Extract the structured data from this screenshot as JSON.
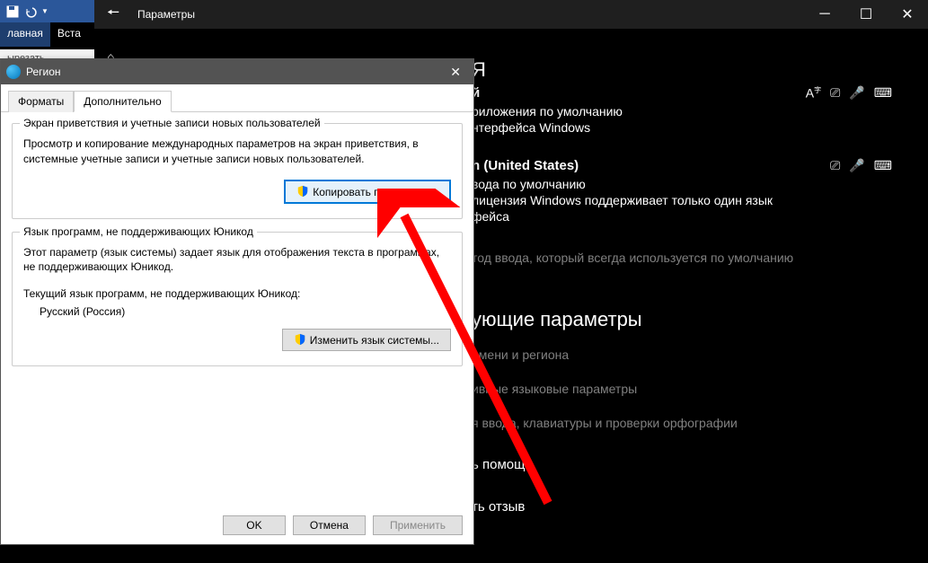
{
  "ribbon": {
    "tab_home": "лавная",
    "tab_insert": "Вста",
    "cut": "ырезать"
  },
  "settings": {
    "title": "Параметры",
    "home_icon": "⌂",
    "search_letter": "Я",
    "lang1": {
      "name_suffix": "й",
      "line1": "риложения по умолчанию",
      "line2": "нтерфейса Windows"
    },
    "lang2": {
      "name": "h (United States)",
      "line1": "вода по умолчанию",
      "line2": "лицензия Windows поддерживает только один язык",
      "line3": "фейса"
    },
    "input_method": "тод ввода, который всегда используется по умолчанию",
    "related_heading": "ующие параметры",
    "related1": "емени и региона",
    "related2": "ивные языковые параметры",
    "related3": "я ввода, клавиатуры и проверки орфографии",
    "help_heading": "ь помощь",
    "feedback": "ть отзыв"
  },
  "region": {
    "title": "Регион",
    "tab_formats": "Форматы",
    "tab_advanced": "Дополнительно",
    "group1": {
      "title": "Экран приветствия и учетные записи новых пользователей",
      "text": "Просмотр и копирование международных параметров на экран приветствия, в системные учетные записи и учетные записи новых пользователей.",
      "button": "Копировать параметры..."
    },
    "group2": {
      "title": "Язык программ, не поддерживающих Юникод",
      "text": "Этот параметр (язык системы) задает язык для отображения текста в программах, не поддерживающих Юникод.",
      "label": "Текущий язык программ, не поддерживающих Юникод:",
      "value": "Русский (Россия)",
      "button": "Изменить язык системы..."
    },
    "buttons": {
      "ok": "OK",
      "cancel": "Отмена",
      "apply": "Применить"
    }
  }
}
